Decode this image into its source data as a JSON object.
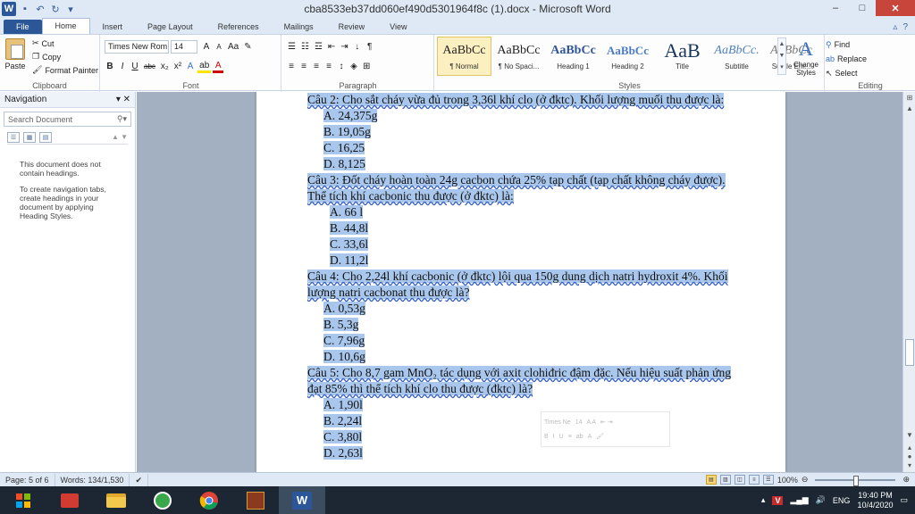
{
  "window": {
    "title": "cba8533eb37dd060ef490d5301964f8c (1).docx - Microsoft Word",
    "app_letter": "W",
    "minimize": "–",
    "maximize": "□",
    "close": "✕"
  },
  "tabs": [
    "File",
    "Home",
    "Insert",
    "Page Layout",
    "References",
    "Mailings",
    "Review",
    "View"
  ],
  "ribbon": {
    "clipboard": {
      "paste": "Paste",
      "cut": "Cut",
      "copy": "Copy",
      "format_painter": "Format Painter",
      "label": "Clipboard"
    },
    "font": {
      "name": "Times New Rom",
      "size": "14",
      "label": "Font",
      "grow": "A",
      "shrink": "A",
      "case": "Aa",
      "bold": "B",
      "italic": "I",
      "underline": "U",
      "strike": "abc",
      "sub": "x₂",
      "sup": "x²",
      "color": "A"
    },
    "paragraph": {
      "label": "Paragraph",
      "pilcrow": "¶"
    },
    "styles": {
      "label": "Styles",
      "items": [
        {
          "preview": "AaBbCc",
          "name": "¶ Normal"
        },
        {
          "preview": "AaBbCc",
          "name": "¶ No Spaci..."
        },
        {
          "preview": "AaBbCc",
          "name": "Heading 1"
        },
        {
          "preview": "AaBbCc",
          "name": "Heading 2"
        },
        {
          "preview": "AaB",
          "name": "Title"
        },
        {
          "preview": "AaBbCc.",
          "name": "Subtitle"
        },
        {
          "preview": "AaBbCc",
          "name": "Subtle Em..."
        }
      ],
      "change_styles": "Change Styles"
    },
    "editing": {
      "label": "Editing",
      "find": "Find",
      "replace": "Replace",
      "select": "Select"
    }
  },
  "navigation": {
    "title": "Navigation",
    "search_placeholder": "Search Document",
    "message1": "This document does not contain headings.",
    "message2": "To create navigation tabs, create headings in your document by applying Heading Styles."
  },
  "document": {
    "lines": [
      {
        "text": "Câu 2: Cho sắt cháy vừa đủ trong 3,36l khí clo (ở đktc). Khối lượng muối thu được là:",
        "kind": "q"
      },
      {
        "text": "A. 24,375g",
        "kind": "opt"
      },
      {
        "text": "B. 19,05g",
        "kind": "opt"
      },
      {
        "text": "C. 16,25",
        "kind": "opt"
      },
      {
        "text": "D. 8,125",
        "kind": "opt"
      },
      {
        "text": "Câu 3: Đốt cháy hoàn toàn 24g cacbon chứa 25% tạp chất (tạp chất không cháy được).",
        "kind": "q"
      },
      {
        "text": "Thể tích khí cacbonic thu được (ở đktc) là:",
        "kind": "q"
      },
      {
        "text": "A. 66 l",
        "kind": "opt2"
      },
      {
        "text": "B. 44,8l",
        "kind": "opt2"
      },
      {
        "text": "C. 33,6l",
        "kind": "opt2"
      },
      {
        "text": "D. 11,2l",
        "kind": "opt2"
      },
      {
        "text": "Câu 4: Cho 2,24l khí cacbonic (ở đktc) lội qua 150g dung dịch natri hydroxit 4%. Khối",
        "kind": "q"
      },
      {
        "text": "lượng natri cacbonat thu được là?",
        "kind": "q"
      },
      {
        "text": "A. 0,53g",
        "kind": "opt"
      },
      {
        "text": "B. 5,3g",
        "kind": "opt"
      },
      {
        "text": "C. 7,96g",
        "kind": "opt"
      },
      {
        "text": "D. 10,6g",
        "kind": "opt"
      },
      {
        "text": "Câu 5: Cho 8,7 gam MnO₂ tác dụng với axit clohiđric đậm đặc. Nếu hiệu suất phản ứng",
        "kind": "q"
      },
      {
        "text": "đạt 85% thì thể tích khí clo thu được (đktc) là?",
        "kind": "q"
      },
      {
        "text": "A. 1,90l",
        "kind": "opt"
      },
      {
        "text": "B. 2,24l",
        "kind": "opt"
      },
      {
        "text": "C. 3,80l",
        "kind": "opt"
      },
      {
        "text": "D. 2,63l",
        "kind": "opt"
      }
    ]
  },
  "mini_toolbar": {
    "font": "Times Ne",
    "size": "14"
  },
  "status": {
    "page": "Page: 5 of 6",
    "words": "Words: 134/1,530",
    "zoom": "100%"
  },
  "taskbar": {
    "lang": "ENG",
    "time": "19:40 PM",
    "date": "10/4/2020"
  }
}
